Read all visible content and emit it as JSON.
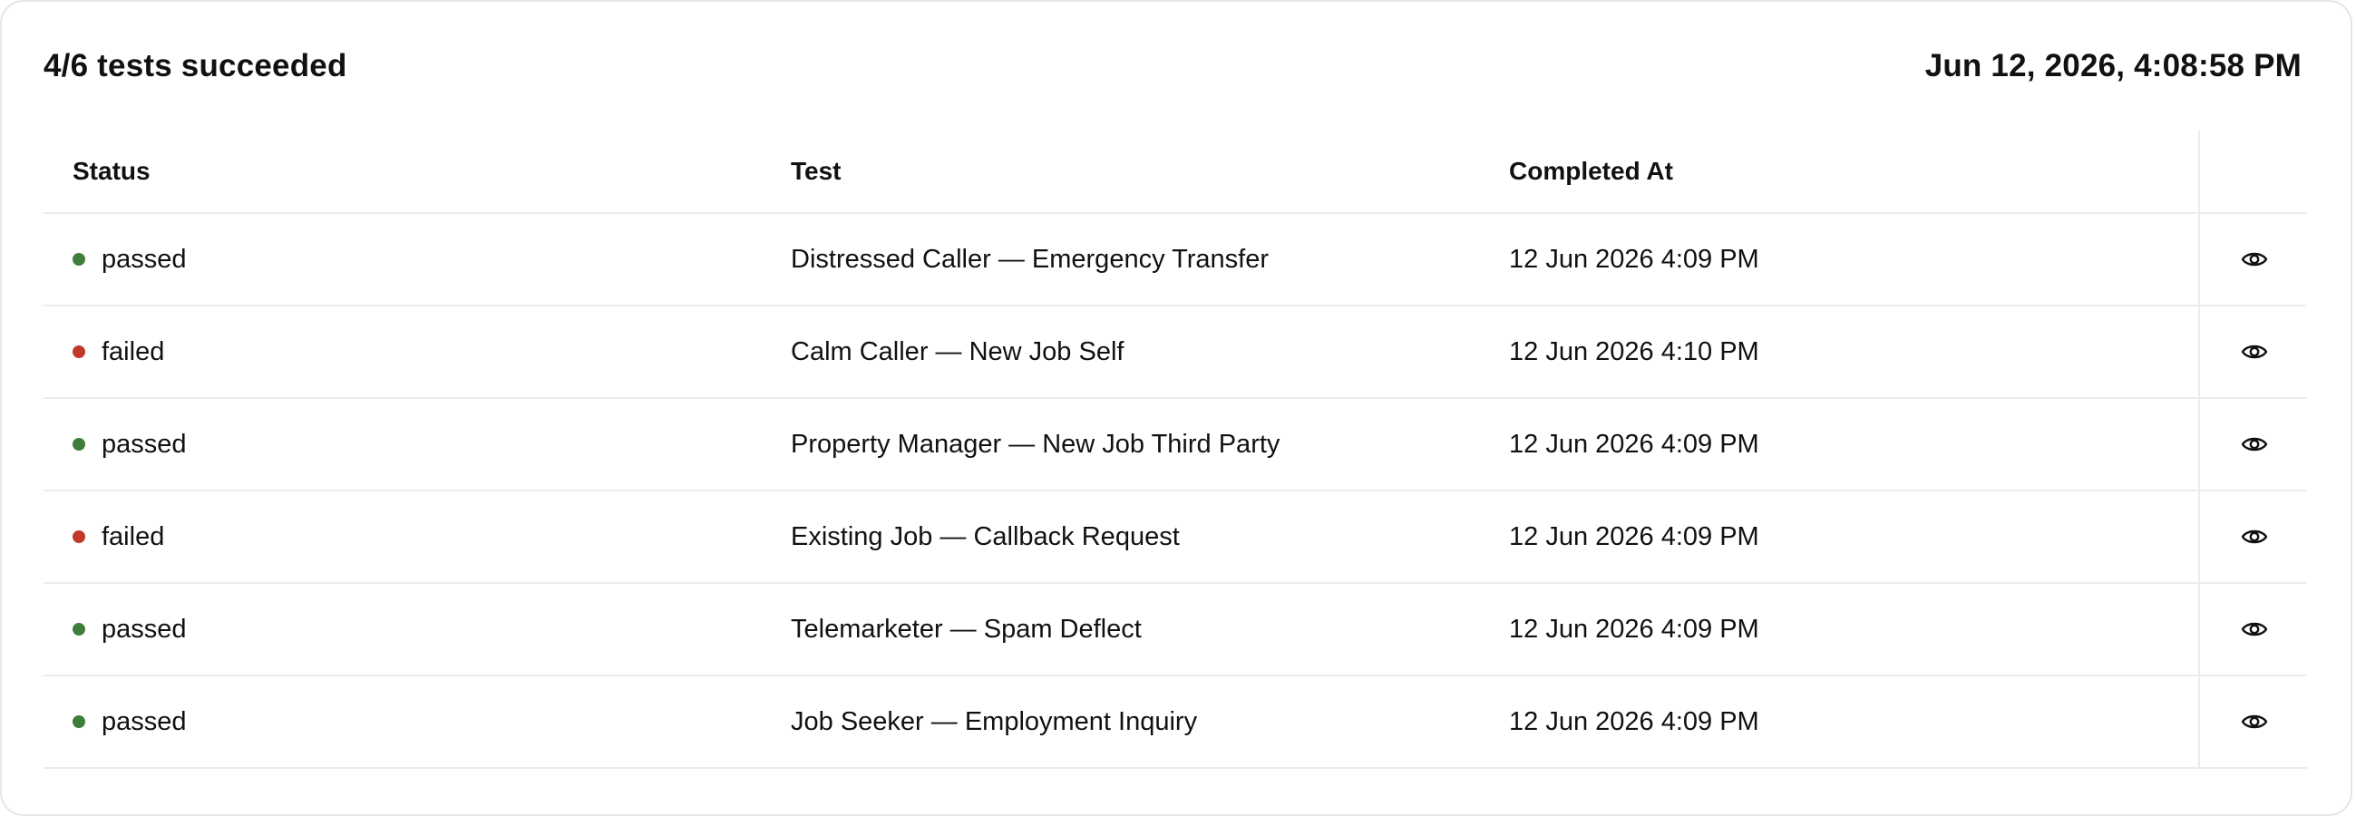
{
  "header": {
    "summary": "4/6 tests succeeded",
    "run_time": "Jun 12, 2026, 4:08:58 PM"
  },
  "table": {
    "columns": {
      "status": "Status",
      "test": "Test",
      "completed_at": "Completed At"
    },
    "rows": [
      {
        "status": "passed",
        "test": "Distressed Caller — Emergency Transfer",
        "completed_at": "12 Jun 2026 4:09 PM"
      },
      {
        "status": "failed",
        "test": "Calm Caller — New Job Self",
        "completed_at": "12 Jun 2026 4:10 PM"
      },
      {
        "status": "passed",
        "test": "Property Manager — New Job Third Party",
        "completed_at": "12 Jun 2026 4:09 PM"
      },
      {
        "status": "failed",
        "test": "Existing Job — Callback Request",
        "completed_at": "12 Jun 2026 4:09 PM"
      },
      {
        "status": "passed",
        "test": "Telemarketer — Spam Deflect",
        "completed_at": "12 Jun 2026 4:09 PM"
      },
      {
        "status": "passed",
        "test": "Job Seeker — Employment Inquiry",
        "completed_at": "12 Jun 2026 4:09 PM"
      }
    ]
  },
  "icons": {
    "view": "eye-icon"
  },
  "colors": {
    "passed": "#3f7d3a",
    "failed": "#c0392b",
    "border": "#ececec"
  }
}
